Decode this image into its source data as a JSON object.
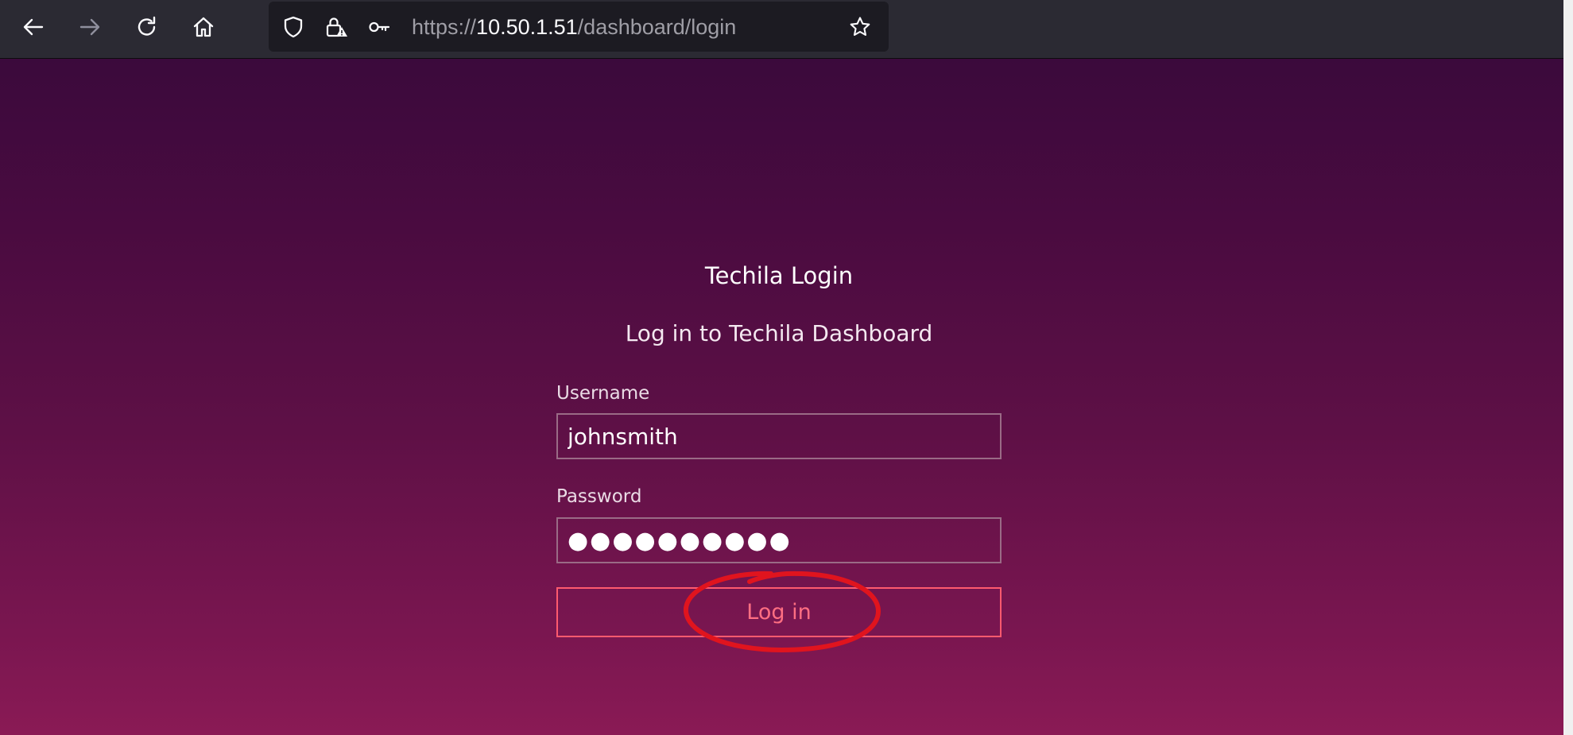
{
  "browser": {
    "url_scheme": "https://",
    "url_host": "10.50.1.51",
    "url_path": "/dashboard/login",
    "icons": [
      "back-arrow-icon",
      "forward-arrow-icon",
      "reload-icon",
      "home-icon",
      "shield-icon",
      "lock-warning-icon",
      "key-icon",
      "star-icon"
    ]
  },
  "login": {
    "title": "Techila Login",
    "subtitle": "Log in to Techila Dashboard",
    "username_label": "Username",
    "username_value": "johnsmith",
    "password_label": "Password",
    "password_mask": "●●●●●●●●●●",
    "button_label": "Log in"
  },
  "colors": {
    "page_gradient_top": "#3b0a3c",
    "page_gradient_bottom": "#8a1a55",
    "button_accent": "#ff5a6e",
    "annotation": "#e0141e"
  }
}
